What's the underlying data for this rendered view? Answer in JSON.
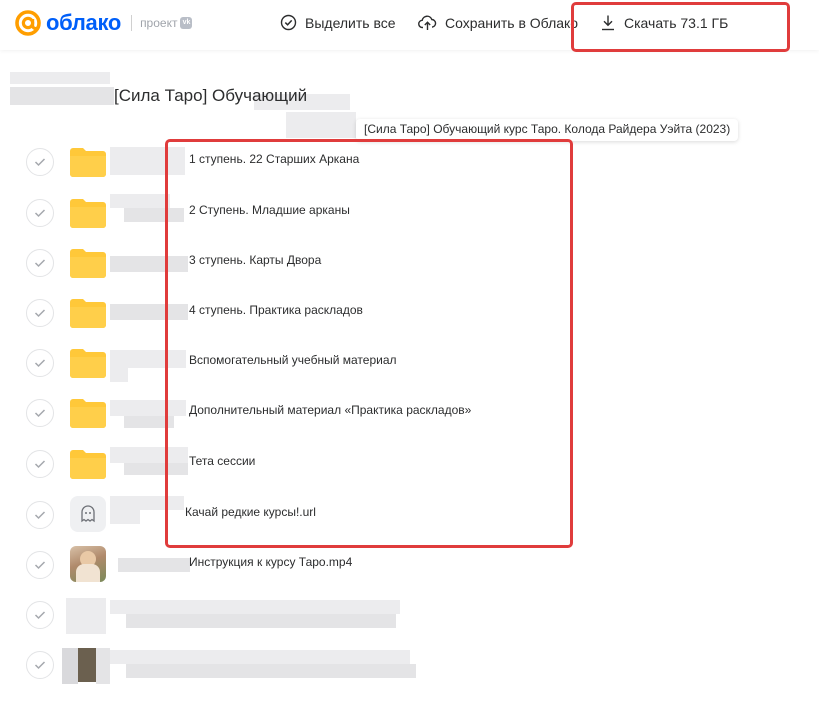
{
  "header": {
    "logo_text": "облако",
    "logo_project": "проект",
    "vk_badge": "vk",
    "select_all": "Выделить все",
    "save_to_cloud": "Сохранить в Облако",
    "download": "Скачать 73.1 ГБ"
  },
  "breadcrumb": "[Сила Таро] Обучающий",
  "tooltip": "[Сила Таро] Обучающий курс Таро. Колода Райдера Уэйта (2023)",
  "items": [
    {
      "name": "1 ступень. 22 Старших Аркана",
      "type": "folder"
    },
    {
      "name": "2 Ступень. Младшие арканы",
      "type": "folder"
    },
    {
      "name": "3 ступень. Карты Двора",
      "type": "folder"
    },
    {
      "name": "4 ступень. Практика раскладов",
      "type": "folder"
    },
    {
      "name": "Вспомогательный учебный материал",
      "type": "folder"
    },
    {
      "name": "Дополнительный материал «Практика раскладов»",
      "type": "folder"
    },
    {
      "name": "Тета сессии",
      "type": "folder"
    },
    {
      "name": "Качай редкие курсы!.url",
      "type": "url"
    },
    {
      "name": "Инструкция к курсу Таро.mp4",
      "type": "video"
    }
  ],
  "icons": {
    "select_all": "check-circle-icon",
    "save": "cloud-upload-icon",
    "download": "download-icon",
    "row_check": "check-icon",
    "folder": "folder-icon",
    "url": "ghost-icon"
  },
  "colors": {
    "brand_blue": "#005ff9",
    "brand_orange": "#ff9e00",
    "folder": "#ffc839",
    "highlight_red": "#e03c3c"
  }
}
